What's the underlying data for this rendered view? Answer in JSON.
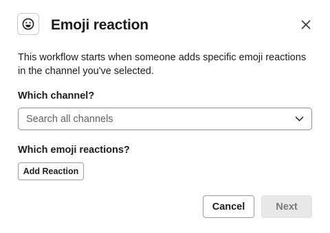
{
  "dialog": {
    "title": "Emoji reaction",
    "header_icon": "smiley-face-icon",
    "close_icon": "close-icon",
    "description": "This workflow starts when someone adds specific emoji reactions in the channel you've selected."
  },
  "channel": {
    "label": "Which channel?",
    "placeholder": "Search all channels",
    "dropdown_icon": "chevron-down-icon"
  },
  "emoji": {
    "label": "Which emoji reactions?",
    "add_button": "Add Reaction"
  },
  "footer": {
    "cancel_label": "Cancel",
    "next_label": "Next"
  },
  "colors": {
    "text": "#1d1c1d",
    "placeholder": "#616061",
    "border": "#8d8d8d",
    "next_disabled_bg": "#e8e8e8",
    "next_disabled_text": "#7a7a7a"
  }
}
